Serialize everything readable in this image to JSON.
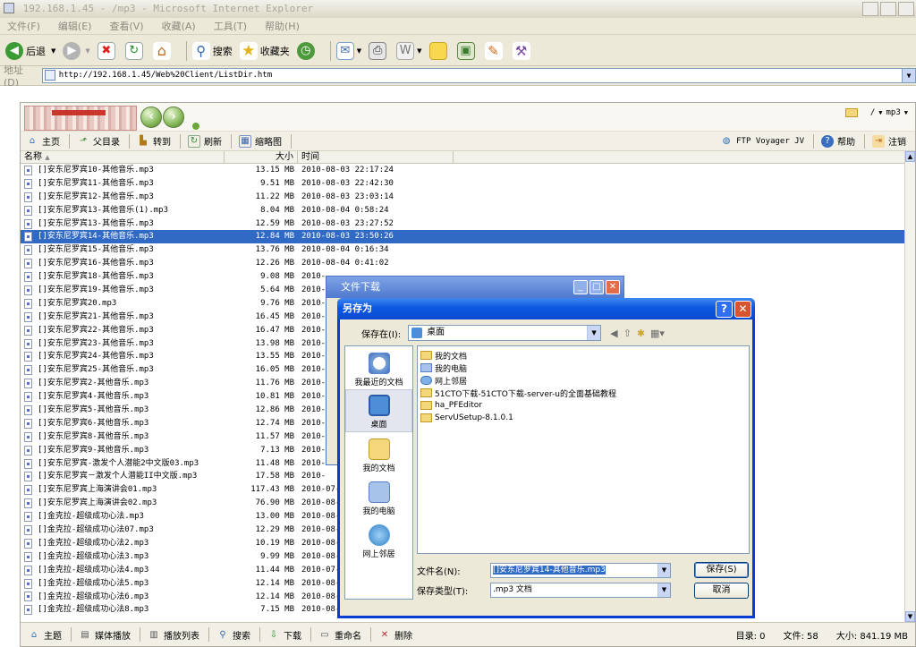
{
  "window": {
    "title": "192.168.1.45 - /mp3 - Microsoft Internet Explorer"
  },
  "menubar": [
    "文件(F)",
    "编辑(E)",
    "查看(V)",
    "收藏(A)",
    "工具(T)",
    "帮助(H)"
  ],
  "ie_toolbar": {
    "back_label": "后退",
    "search_label": "搜索",
    "favorites_label": "收藏夹"
  },
  "address": {
    "label": "地址(D)",
    "url": "http://192.168.1.45/Web%20Client/ListDir.htm"
  },
  "ftp": {
    "path": {
      "root": "/",
      "current": "mp3"
    },
    "toolbar": {
      "home": "主页",
      "parent": "父目录",
      "goto": "转到",
      "refresh": "刷新",
      "thumbs": "缩略图",
      "voyager": "FTP Voyager JV",
      "help": "帮助",
      "logout": "注销"
    },
    "columns": {
      "name": "名称",
      "size": "大小",
      "time": "时间"
    },
    "files": [
      {
        "name": "[]安东尼罗宾10-其他音乐.mp3",
        "size": "13.15 MB",
        "time": "2010-08-03 22:17:24"
      },
      {
        "name": "[]安东尼罗宾11-其他音乐.mp3",
        "size": "9.51 MB",
        "time": "2010-08-03 22:42:30"
      },
      {
        "name": "[]安东尼罗宾12-其他音乐.mp3",
        "size": "11.22 MB",
        "time": "2010-08-03 23:03:14"
      },
      {
        "name": "[]安东尼罗宾13-其他音乐(1).mp3",
        "size": "8.04 MB",
        "time": "2010-08-04 0:58:24"
      },
      {
        "name": "[]安东尼罗宾13-其他音乐.mp3",
        "size": "12.59 MB",
        "time": "2010-08-03 23:27:52"
      },
      {
        "name": "[]安东尼罗宾14-其他音乐.mp3",
        "size": "12.84 MB",
        "time": "2010-08-03 23:50:26",
        "selected": true
      },
      {
        "name": "[]安东尼罗宾15-其他音乐.mp3",
        "size": "13.76 MB",
        "time": "2010-08-04 0:16:34"
      },
      {
        "name": "[]安东尼罗宾16-其他音乐.mp3",
        "size": "12.26 MB",
        "time": "2010-08-04 0:41:02"
      },
      {
        "name": "[]安东尼罗宾18-其他音乐.mp3",
        "size": "9.08 MB",
        "time": "2010-"
      },
      {
        "name": "[]安东尼罗宾19-其他音乐.mp3",
        "size": "5.64 MB",
        "time": "2010-"
      },
      {
        "name": "[]安东尼罗宾20.mp3",
        "size": "9.76 MB",
        "time": "2010-"
      },
      {
        "name": "[]安东尼罗宾21-其他音乐.mp3",
        "size": "16.45 MB",
        "time": "2010-"
      },
      {
        "name": "[]安东尼罗宾22-其他音乐.mp3",
        "size": "16.47 MB",
        "time": "2010-"
      },
      {
        "name": "[]安东尼罗宾23-其他音乐.mp3",
        "size": "13.98 MB",
        "time": "2010-"
      },
      {
        "name": "[]安东尼罗宾24-其他音乐.mp3",
        "size": "13.55 MB",
        "time": "2010-"
      },
      {
        "name": "[]安东尼罗宾25-其他音乐.mp3",
        "size": "16.05 MB",
        "time": "2010-"
      },
      {
        "name": "[]安东尼罗宾2-其他音乐.mp3",
        "size": "11.76 MB",
        "time": "2010-"
      },
      {
        "name": "[]安东尼罗宾4-其他音乐.mp3",
        "size": "10.81 MB",
        "time": "2010-"
      },
      {
        "name": "[]安东尼罗宾5-其他音乐.mp3",
        "size": "12.86 MB",
        "time": "2010-"
      },
      {
        "name": "[]安东尼罗宾6-其他音乐.mp3",
        "size": "12.74 MB",
        "time": "2010-"
      },
      {
        "name": "[]安东尼罗宾8-其他音乐.mp3",
        "size": "11.57 MB",
        "time": "2010-"
      },
      {
        "name": "[]安东尼罗宾9-其他音乐.mp3",
        "size": "7.13 MB",
        "time": "2010-"
      },
      {
        "name": "[]安东尼罗宾-激发个人潜能2中文版03.mp3",
        "size": "11.48 MB",
        "time": "2010-"
      },
      {
        "name": "[]安东尼罗宾－激发个人潜能II中文版.mp3",
        "size": "17.58 MB",
        "time": "2010-"
      },
      {
        "name": "[]安东尼罗宾上海演讲会01.mp3",
        "size": "117.43 MB",
        "time": "2010-07-"
      },
      {
        "name": "[]安东尼罗宾上海演讲会02.mp3",
        "size": "76.90 MB",
        "time": "2010-08-"
      },
      {
        "name": "[]金克拉-超级成功心法.mp3",
        "size": "13.00 MB",
        "time": "2010-08-"
      },
      {
        "name": "[]金克拉-超级成功心法07.mp3",
        "size": "12.29 MB",
        "time": "2010-08-"
      },
      {
        "name": "[]金克拉-超级成功心法2.mp3",
        "size": "10.19 MB",
        "time": "2010-08-"
      },
      {
        "name": "[]金克拉-超级成功心法3.mp3",
        "size": "9.99 MB",
        "time": "2010-08-"
      },
      {
        "name": "[]金克拉-超级成功心法4.mp3",
        "size": "11.44 MB",
        "time": "2010-07-"
      },
      {
        "name": "[]金克拉-超级成功心法5.mp3",
        "size": "12.14 MB",
        "time": "2010-08-"
      },
      {
        "name": "[]金克拉-超级成功心法6.mp3",
        "size": "12.14 MB",
        "time": "2010-08-"
      },
      {
        "name": "[]金克拉-超级成功心法8.mp3",
        "size": "7.15 MB",
        "time": "2010-08-03 19:42:22"
      }
    ],
    "statusbar": {
      "home": "主题",
      "player": "媒体播放",
      "playlist": "播放列表",
      "search": "搜索",
      "download": "下载",
      "rename": "重命名",
      "delete": "删除"
    },
    "stats": {
      "dirs": "目录: 0",
      "files": "文件: 58",
      "size": "大小: 841.19 MB"
    }
  },
  "download_dialog": {
    "title": "文件下载"
  },
  "save_as": {
    "title": "另存为",
    "save_in_label": "保存在(I):",
    "save_in_value": "桌面",
    "places": [
      "我最近的文档",
      "桌面",
      "我的文档",
      "我的电脑",
      "网上邻居"
    ],
    "items": [
      {
        "name": "我的文档",
        "icon": "doc"
      },
      {
        "name": "我的电脑",
        "icon": "pc"
      },
      {
        "name": "网上邻居",
        "icon": "net"
      },
      {
        "name": "51CTO下载-51CTO下载-server-u的全面基础教程",
        "icon": "folder"
      },
      {
        "name": "ha_PFEditor",
        "icon": "folder"
      },
      {
        "name": "ServUSetup-8.1.0.1",
        "icon": "folder"
      }
    ],
    "filename_label": "文件名(N):",
    "filename_value": "[]安东尼罗宾14-其他音乐.mp3",
    "filetype_label": "保存类型(T):",
    "filetype_value": ".mp3 文档",
    "save_button": "保存(S)",
    "cancel_button": "取消"
  },
  "colors": {
    "selection": "#316ac5",
    "xp_title": "#0a4bd1",
    "xp_face": "#ece9d8"
  }
}
